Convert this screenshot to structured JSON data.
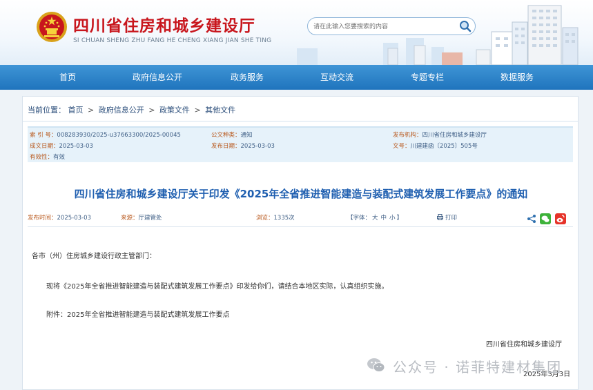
{
  "header": {
    "title": "四川省住房和城乡建设厅",
    "subtitle": "SI CHUAN SHENG ZHU FANG HE CHENG XIANG JIAN SHE TING",
    "emblem_icon": "national-emblem-icon"
  },
  "search": {
    "placeholder": "请在此输入您要搜索的内容",
    "icon": "search-icon"
  },
  "nav": {
    "items": [
      "首页",
      "政府信息公开",
      "政务服务",
      "互动交流",
      "专题专栏",
      "数据服务"
    ]
  },
  "breadcrumb": {
    "label": "当前位置：",
    "items": [
      "首页",
      "政府信息公开",
      "政策文件",
      "其他文件"
    ],
    "separator": ">"
  },
  "meta": {
    "index_label": "索 引 号：",
    "index_value": "008283930/2025-u37663300/2025-00045",
    "type_label": "公文种类：",
    "type_value": "通知",
    "issuer_label": "发布机构：",
    "issuer_value": "四川省住房和城乡建设厅",
    "created_label": "成文日期：",
    "created_value": "2025-03-03",
    "published_label": "发布日期：",
    "published_value": "2025-03-03",
    "docno_label": "文号：",
    "docno_value": "川建建函〔2025〕505号",
    "validity_label": "有效性：",
    "validity_value": "有效"
  },
  "document": {
    "title": "四川省住房和城乡建设厅关于印发《2025年全省推进智能建造与装配式建筑发展工作要点》的通知",
    "publish_time_label": "发布时间：",
    "publish_time": "2025-03-03",
    "source_label": "来源：",
    "source": "厅建管处",
    "views_label": "浏览：",
    "views": "1335次",
    "fontsize_label": "【字体：",
    "fontsize_large": "大",
    "fontsize_medium": "中",
    "fontsize_small": "小",
    "fontsize_end": "】",
    "print_label": "打印",
    "greeting": "各市（州）住房城乡建设行政主管部门：",
    "paragraph1": "现将《2025年全省推进智能建造与装配式建筑发展工作要点》印发给你们，请结合本地区实际，认真组织实施。",
    "attachment": "附件：2025年全省推进智能建造与装配式建筑发展工作要点",
    "signature": "四川省住房和城乡建设厅",
    "date": "2025年3月3日"
  },
  "watermark": {
    "text": "公众号 · 诺菲特建材集团"
  },
  "colors": {
    "nav_bg": "#1f74bd",
    "title_red": "#c8161d",
    "doc_title_blue": "#1f5fb0",
    "meta_label_orange": "#b8571b",
    "meta_bg": "#e6f2fa"
  }
}
